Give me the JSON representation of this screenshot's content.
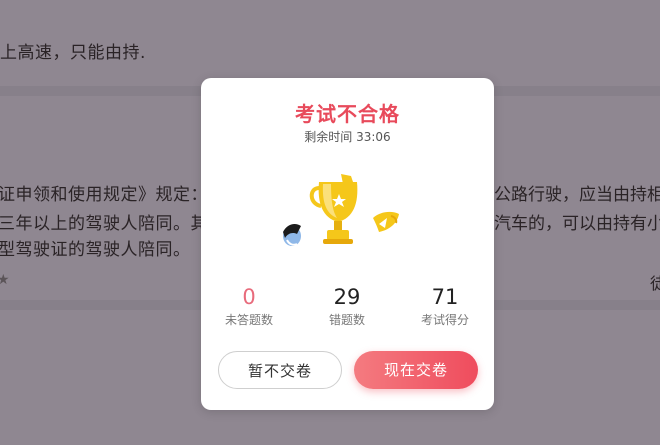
{
  "background": {
    "line1": "上高速，只能由持.",
    "line2": "证申领和使用规定》规定：",
    "line2_right": "公路行驶，应当由持相",
    "line3": "三年以上的驾驶人陪同。其",
    "line3_right": "汽车的，可以由持有小",
    "line4": "型驾驶证的驾驶人陪同。",
    "right_glyph": "徒"
  },
  "modal": {
    "title": "考试不合格",
    "timer": "剩余时间 33:06",
    "stats": [
      {
        "value": "0",
        "label": "未答题数"
      },
      {
        "value": "29",
        "label": "错题数"
      },
      {
        "value": "71",
        "label": "考试得分"
      }
    ],
    "cancel_label": "暂不交卷",
    "submit_label": "现在交卷"
  },
  "colors": {
    "title": "#e84a5b",
    "accent": "#ef4c5d",
    "unanswered": "#e86b7c",
    "trophy": "#f5c71a"
  },
  "icons": {
    "trophy": "broken-trophy-icon"
  }
}
